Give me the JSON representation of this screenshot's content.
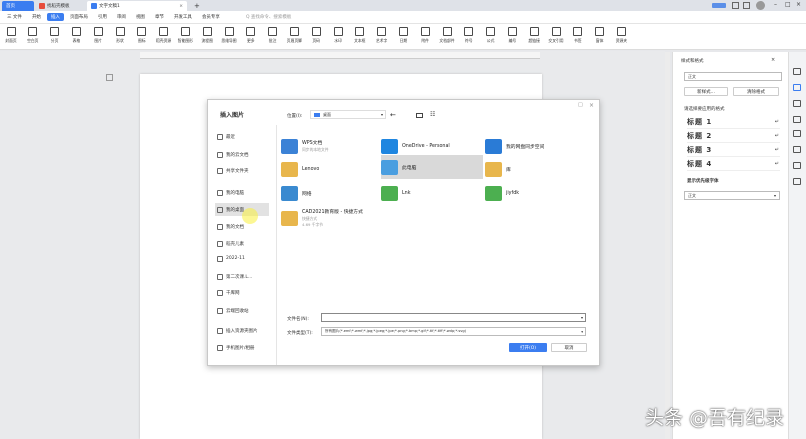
{
  "tabs": [
    {
      "label": "首页",
      "color": "#3b7df0"
    },
    {
      "label": "找稻壳模板",
      "color": "#e74c3c"
    },
    {
      "label": "文字文稿1",
      "color": "#3b7df0"
    }
  ],
  "add_tab": "+",
  "menu": [
    "三 文件",
    "开始",
    "插入",
    "页面布局",
    "引用",
    "审阅",
    "视图",
    "章节",
    "开发工具",
    "会员专享",
    "Q 查找命令、搜索模板"
  ],
  "menu_active_index": 2,
  "toolbar": [
    "封面页",
    "空白页",
    "分页",
    "表格",
    "图片",
    "形状",
    "图标",
    "稻壳资源",
    "智能图形",
    "流程图",
    "思维导图",
    "更多",
    "批注",
    "页眉页脚",
    "页码",
    "水印",
    "文本框",
    "艺术字",
    "日期",
    "附件",
    "文档部件",
    "符号",
    "公式",
    "编号",
    "超链接",
    "交叉引用",
    "书签",
    "窗体",
    "资源夹"
  ],
  "dialog": {
    "title": "插入图片",
    "location_label": "位置(I):",
    "location_value": "桌面",
    "sidebar": [
      "最近",
      "我的云文档",
      "共享文件夹",
      "我的电脑",
      "我的桌面",
      "我的文档",
      "稻壳儿素",
      "2022-11",
      "第二次课.L...",
      "千库网",
      "云端回收站",
      "插入资源夹图片",
      "手机图片/相册"
    ],
    "selected_sidebar": 4,
    "items": [
      {
        "name": "WPS文档",
        "sub": "同步的本地文件",
        "color": "#3b82d6"
      },
      {
        "name": "OneDrive - Personal",
        "sub": "",
        "color": "#1f86e0"
      },
      {
        "name": "我的网盘同步空间",
        "sub": "",
        "color": "#2a7bd6"
      },
      {
        "name": "Lenovo",
        "sub": "",
        "color": "#e8b64c"
      },
      {
        "name": "此电脑",
        "sub": "",
        "color": "#4a9ee0"
      },
      {
        "name": "库",
        "sub": "",
        "color": "#e8b64c"
      },
      {
        "name": "网络",
        "sub": "",
        "color": "#3a8ad0"
      },
      {
        "name": "Lnk",
        "sub": "",
        "color": "#4caf50"
      },
      {
        "name": "jiyfdk",
        "sub": "",
        "color": "#4caf50"
      },
      {
        "name": "CAD2021教育版 - 快捷方式",
        "sub": "快捷方式\n4.69 千字节",
        "color": "#e8b64c"
      }
    ],
    "selected_item": 4,
    "filename_label": "文件名(N):",
    "filename_value": "",
    "filetype_label": "文件类型(T):",
    "filetype_value": "所有图片(*.emf;*.wmf;*.jpg;*.jpeg;*.jpe;*.png;*.bmp;*.gif;*.tif;*.tiff;*.wdp;*.svg)",
    "open_button": "打开(O)",
    "cancel_button": "取消"
  },
  "panel": {
    "title": "样式和格式",
    "current_style": "正文",
    "new_style": "新样式...",
    "clear_format": "清除格式",
    "hint": "请选择要应用的格式",
    "styles": [
      "标题 1",
      "标题 2",
      "标题 3",
      "标题 4"
    ],
    "show_label": "显示优先级字体",
    "show_value": "正文"
  },
  "watermark": "头条 @吾有纪录"
}
